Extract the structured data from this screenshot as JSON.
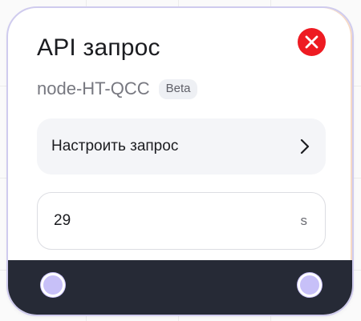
{
  "node": {
    "title": "API запрос",
    "node_id": "node-HT-QCC",
    "badge": "Beta",
    "config_label": "Настроить запрос",
    "timeout_value": "29",
    "timeout_unit": "s"
  },
  "icons": {
    "close": "close-icon",
    "chevron": "chevron-right-icon",
    "input_port": "input-port-dot",
    "output_port": "output-port-dot"
  },
  "colors": {
    "close": "#ee1b22",
    "footer": "#262a36",
    "port": "#c7c0f8",
    "border": "#cfcbee"
  }
}
